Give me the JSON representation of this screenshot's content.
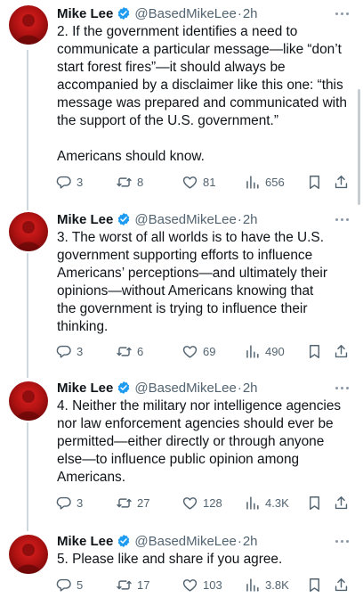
{
  "tweets": [
    {
      "name": "Mike Lee",
      "handle": "@BasedMikeLee",
      "dot": "·",
      "time": "2h",
      "text": "2. If the government identifies a need to\ncommunicate a particular message—like “don’t\nstart forest fires”—it should always be\naccompanied by a disclaimer like this one: “this\nmessage was prepared and communicated with\nthe support of the U.S. government.”\n\nAmericans should know.",
      "replies": "3",
      "retweets": "8",
      "likes": "81",
      "views": "656"
    },
    {
      "name": "Mike Lee",
      "handle": "@BasedMikeLee",
      "dot": "·",
      "time": "2h",
      "text": "3. The worst of all worlds is to have the U.S.\ngovernment supporting efforts to influence\nAmericans’ perceptions—and ultimately their\nopinions—without Americans knowing that\nthe government is trying to influence their\nthinking.",
      "replies": "3",
      "retweets": "6",
      "likes": "69",
      "views": "490"
    },
    {
      "name": "Mike Lee",
      "handle": "@BasedMikeLee",
      "dot": "·",
      "time": "2h",
      "text": "4. Neither the military nor intelligence agencies\nnor law enforcement agencies should ever be\npermitted—either directly or through anyone\nelse—to influence public opinion among\nAmericans.",
      "replies": "3",
      "retweets": "27",
      "likes": "128",
      "views": "4.3K"
    },
    {
      "name": "Mike Lee",
      "handle": "@BasedMikeLee",
      "dot": "·",
      "time": "2h",
      "text": "5. Please like and share if you agree.",
      "replies": "5",
      "retweets": "17",
      "likes": "103",
      "views": "3.8K"
    }
  ],
  "icons": {
    "reply": "reply-icon",
    "retweet": "retweet-icon",
    "like": "heart-icon",
    "views": "views-icon",
    "bookmark": "bookmark-icon",
    "share": "share-icon",
    "verified": "verified-badge-icon",
    "more": "more-icon"
  },
  "colors": {
    "text": "#0f1419",
    "secondary": "#536471",
    "verified": "#1d9bf0",
    "thread_line": "#cfd9de"
  }
}
